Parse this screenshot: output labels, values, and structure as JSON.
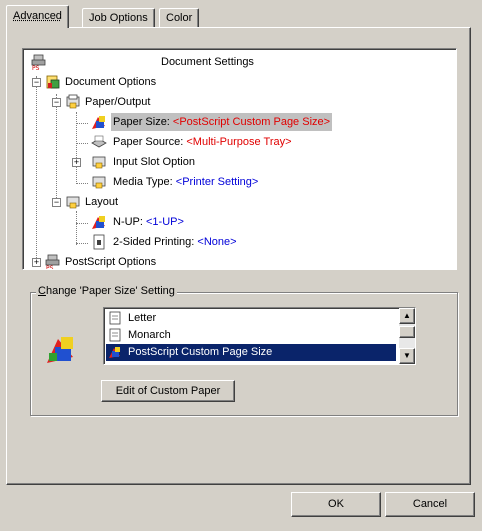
{
  "tabs": [
    {
      "label": "Advanced",
      "active": true
    },
    {
      "label": "Job Options",
      "active": false
    },
    {
      "label": "Color",
      "active": false
    }
  ],
  "tree": {
    "root": "Document Settings",
    "document_options": "Document Options",
    "paper_output": "Paper/Output",
    "paper_size_label": "Paper Size: ",
    "paper_size_value": "<PostScript Custom Page Size>",
    "paper_source_label": "Paper Source: ",
    "paper_source_value": "<Multi-Purpose Tray>",
    "input_slot": "Input Slot Option",
    "media_type_label": "Media Type: ",
    "media_type_value": "<Printer Setting>",
    "layout": "Layout",
    "nup_label": "N-UP: ",
    "nup_value": "<1-UP>",
    "two_sided_label": "2-Sided Printing: ",
    "two_sided_value": "<None>",
    "postscript_options": "PostScript Options"
  },
  "group": {
    "title_prefix": "C",
    "title_rest": "hange 'Paper Size' Setting",
    "list_items": [
      "Letter",
      "Monarch",
      "PostScript Custom Page Size"
    ],
    "selected_index": 2,
    "edit_button": "Edit of Custom Paper"
  },
  "buttons": {
    "ok": "OK",
    "cancel": "Cancel"
  },
  "colors": {
    "selection": "#0a246a",
    "value_red": "#e00000",
    "value_blue": "#0000d8"
  }
}
